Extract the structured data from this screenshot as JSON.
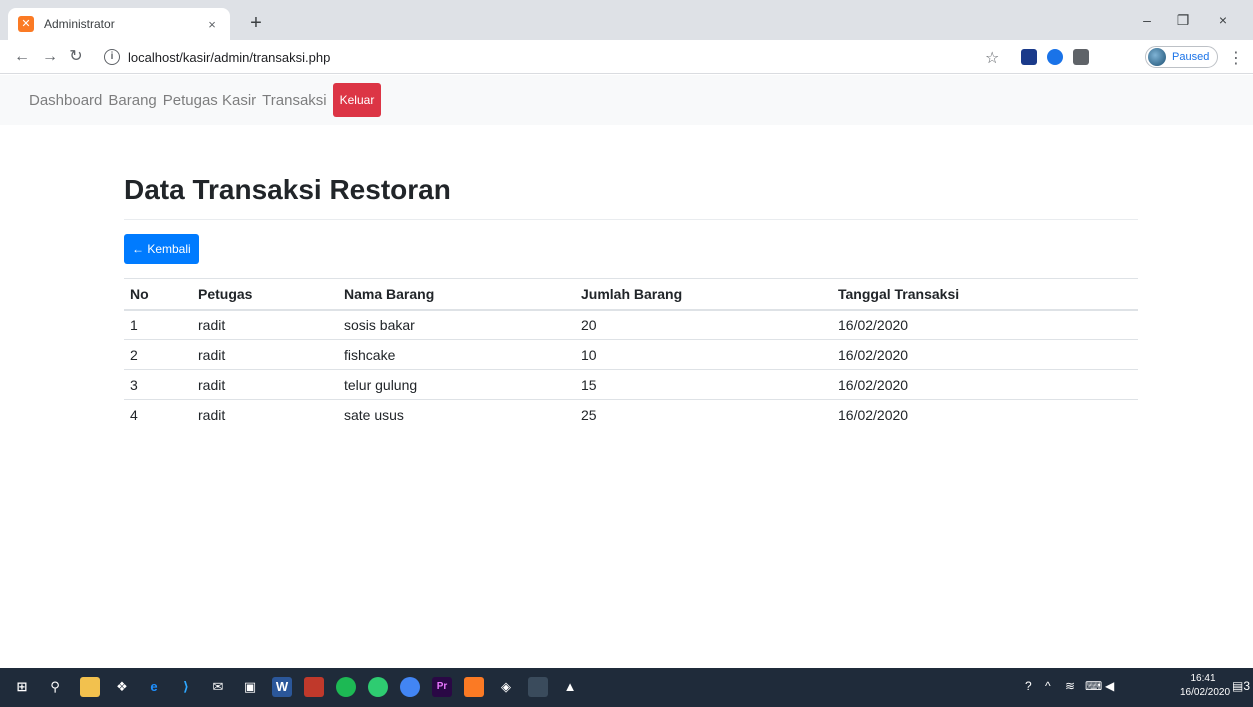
{
  "browser": {
    "tab_title": "Administrator",
    "tab_close": "×",
    "new_tab": "+",
    "url": "localhost/kasir/admin/transaksi.php",
    "profile_status": "Paused",
    "window_controls": [
      "–",
      "❐",
      "×"
    ]
  },
  "navbar": {
    "links": [
      "Dashboard",
      "Barang",
      "Petugas Kasir",
      "Transaksi"
    ],
    "logout": "Keluar"
  },
  "page": {
    "title": "Data Transaksi Restoran",
    "back_button": "← Kembali"
  },
  "table": {
    "headers": [
      "No",
      "Petugas",
      "Nama Barang",
      "Jumlah Barang",
      "Tanggal Transaksi"
    ],
    "rows": [
      [
        "1",
        "radit",
        "sosis bakar",
        "20",
        "16/02/2020"
      ],
      [
        "2",
        "radit",
        "fishcake",
        "10",
        "16/02/2020"
      ],
      [
        "3",
        "radit",
        "telur gulung",
        "15",
        "16/02/2020"
      ],
      [
        "4",
        "radit",
        "sate usus",
        "25",
        "16/02/2020"
      ]
    ]
  },
  "taskbar": {
    "time": "16:41",
    "date": "16/02/2020",
    "notification_count": "3"
  },
  "colors": {
    "primary": "#007bff",
    "danger": "#dc3545",
    "navbar_bg": "#f8f9fa",
    "taskbar_bg": "#1f2b3a"
  }
}
